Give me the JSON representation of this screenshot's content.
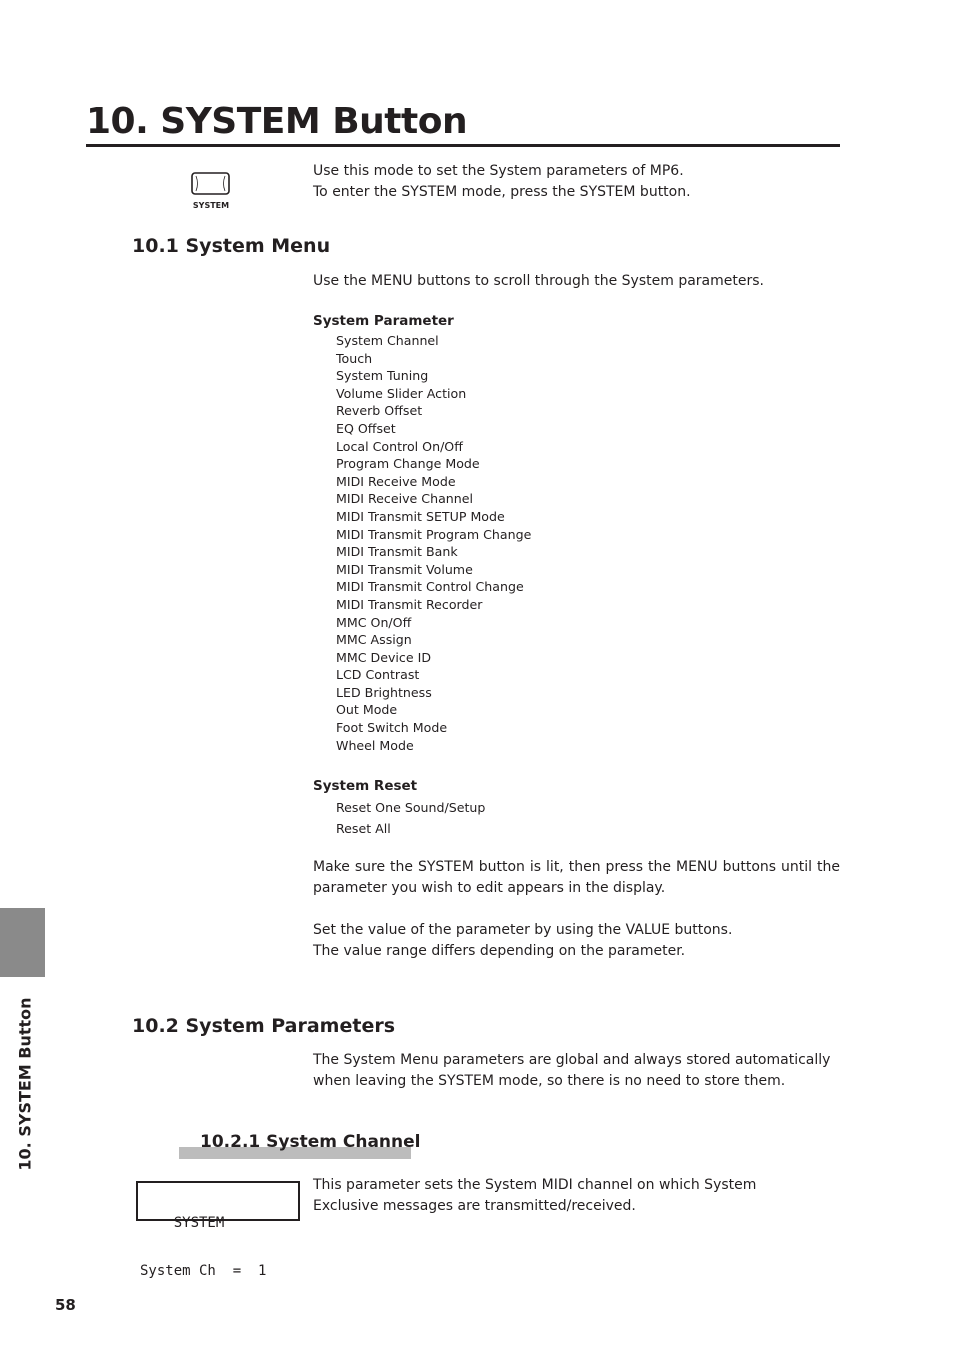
{
  "title": "10. SYSTEM Button",
  "button_icon": {
    "icon": "system-button-icon",
    "label": "SYSTEM"
  },
  "intro": [
    "Use this mode to set the System parameters of MP6.",
    "To enter the SYSTEM mode, press the SYSTEM button."
  ],
  "section1": {
    "heading": "10.1 System Menu",
    "text": "Use the MENU buttons to scroll through the System parameters.",
    "param_heading": "System Parameter",
    "params": [
      "System Channel",
      "Touch",
      "System Tuning",
      "Volume Slider Action",
      "Reverb Offset",
      "EQ Offset",
      "Local Control On/Off",
      "Program Change Mode",
      "MIDI Receive Mode",
      "MIDI Receive Channel",
      "MIDI Transmit SETUP Mode",
      "MIDI Transmit Program Change",
      "MIDI Transmit Bank",
      "MIDI Transmit Volume",
      "MIDI Transmit Control Change",
      "MIDI Transmit Recorder",
      "MMC On/Off",
      "MMC Assign",
      "MMC Device ID",
      "LCD Contrast",
      "LED Brightness",
      "Out Mode",
      "Foot Switch Mode",
      "Wheel Mode"
    ],
    "reset_heading": "System Reset",
    "resets": [
      "Reset One Sound/Setup",
      "Reset All"
    ],
    "para1": "Make sure the SYSTEM button is lit, then press the MENU buttons until the parameter you wish to edit appears in the display.",
    "para2a": "Set the value of the parameter by using the VALUE buttons.",
    "para2b": "The value range differs depending on the parameter."
  },
  "section2": {
    "heading": "10.2 System Parameters",
    "text": "The System Menu parameters are global and always stored automatically when leaving the SYSTEM mode, so there is no need to store them."
  },
  "section3": {
    "heading": "10.2.1 System Channel",
    "lcd_line1": "    SYSTEM",
    "lcd_line2": "System Ch  =  1",
    "text": "This parameter sets the System MIDI channel on which System Exclusive messages are transmitted/received."
  },
  "side_tab": "10. SYSTEM Button",
  "page_number": "58",
  "colors": {
    "text": "#231f20",
    "tab": "#8a8a8a",
    "subheading_bar": "#bcbcbc"
  }
}
